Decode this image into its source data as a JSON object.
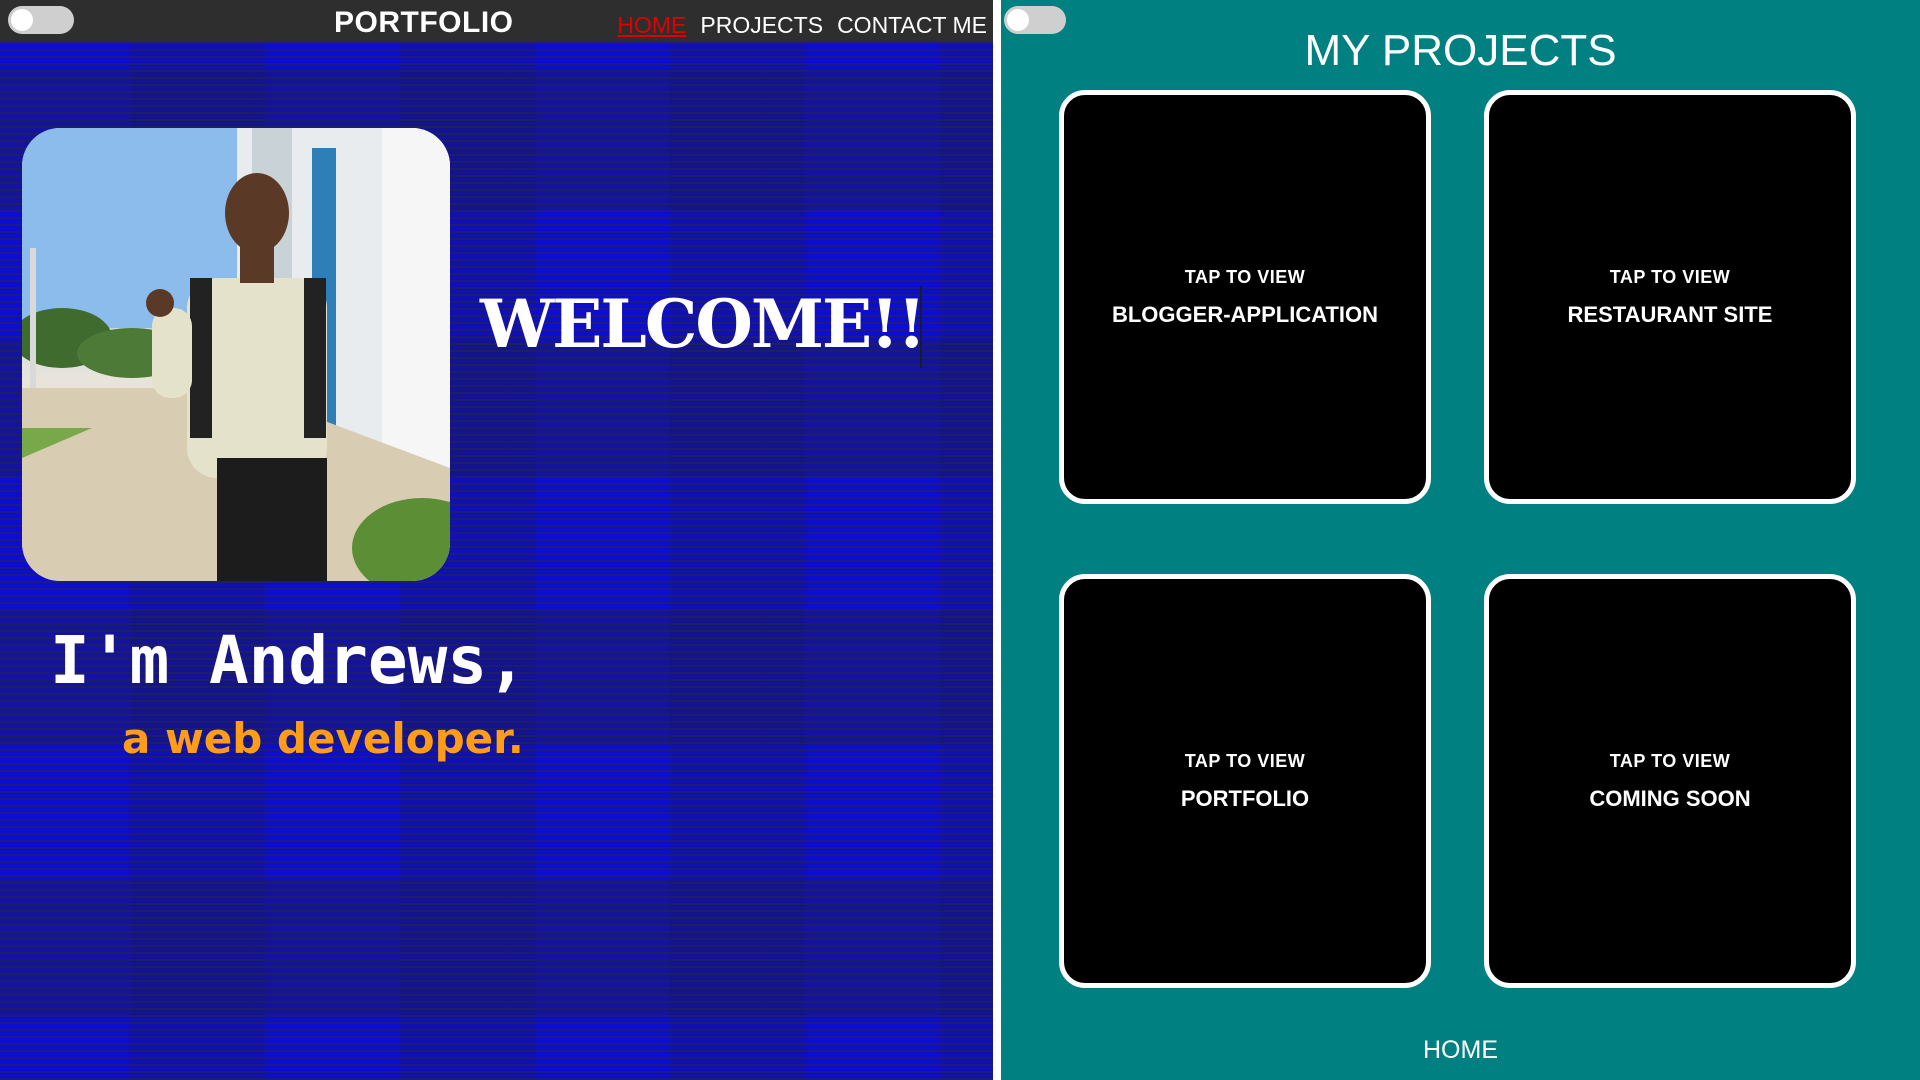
{
  "home_page": {
    "brand": "PORTFOLIO",
    "nav": [
      {
        "label": "HOME",
        "active": true
      },
      {
        "label": "PROJECTS",
        "active": false
      },
      {
        "label": "CONTACT ME",
        "active": false
      }
    ],
    "welcome": "WELCOME!!",
    "intro_name": "I'm Andrews,",
    "intro_role": "a web developer.",
    "photo_icon": "profile-photo",
    "colors": {
      "background": "#0d0dd2",
      "navbar": "#2e2e2e",
      "active_nav": "#e00000",
      "role_text": "#ff9d1a"
    }
  },
  "projects_page": {
    "title": "MY PROJECTS",
    "cards": [
      {
        "tap": "TAP TO VIEW",
        "name": "BLOGGER-APPLICATION"
      },
      {
        "tap": "TAP TO VIEW",
        "name": "RESTAURANT SITE"
      },
      {
        "tap": "TAP TO VIEW",
        "name": "PORTFOLIO"
      },
      {
        "tap": "TAP TO VIEW",
        "name": "COMING SOON"
      }
    ],
    "home_link": "HOME",
    "colors": {
      "background": "#008080",
      "card": "#000000",
      "card_border": "#ffffff"
    }
  },
  "toggle_icon": "toggle-switch-icon"
}
